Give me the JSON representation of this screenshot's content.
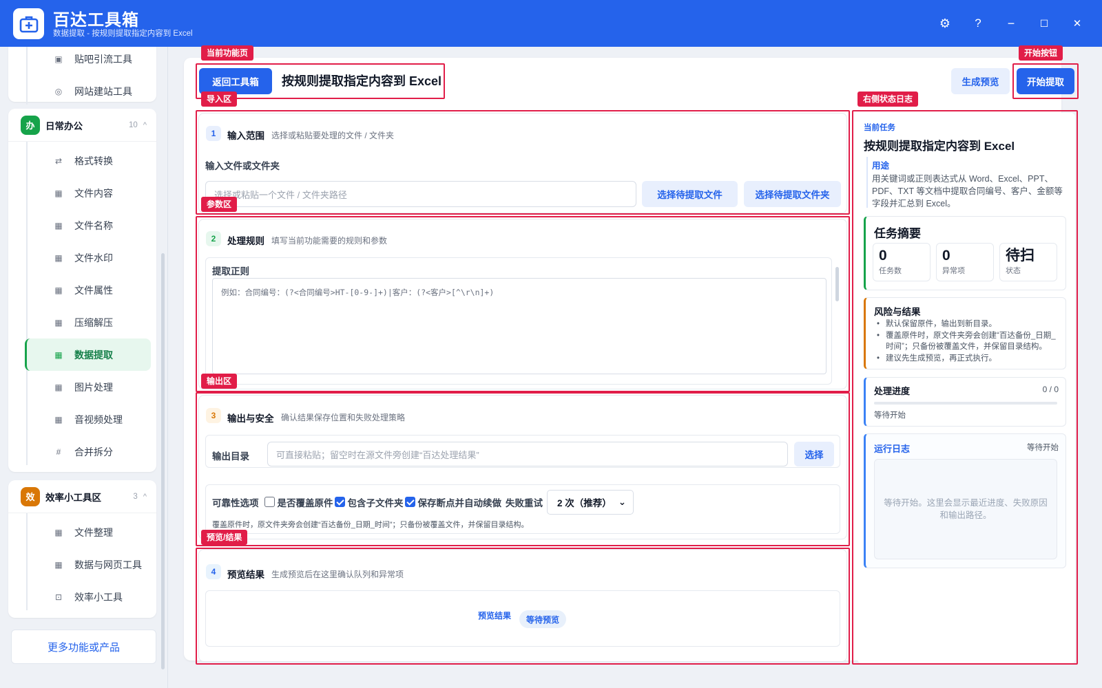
{
  "app": {
    "title": "百达工具箱",
    "subtitle": "数据提取 - 按规则提取指定内容到 Excel"
  },
  "window": {
    "settings_glyph": "⚙",
    "help_glyph": "?",
    "minimize_glyph": "−",
    "maximize_glyph": "☐",
    "close_glyph": "✕"
  },
  "sidebar": {
    "top_items": [
      {
        "label": "贴吧引流工具",
        "icon": "grid-icon"
      },
      {
        "label": "网站建站工具",
        "icon": "globe-icon"
      }
    ],
    "groups": [
      {
        "badge": "办",
        "color": "#16a34a",
        "name": "日常办公",
        "count": "10",
        "caret": "^",
        "items": [
          {
            "label": "格式转换",
            "icon": "swap-icon"
          },
          {
            "label": "文件内容",
            "icon": "grid-icon"
          },
          {
            "label": "文件名称",
            "icon": "grid-icon"
          },
          {
            "label": "文件水印",
            "icon": "grid-icon"
          },
          {
            "label": "文件属性",
            "icon": "grid-icon"
          },
          {
            "label": "压缩解压",
            "icon": "grid-icon"
          },
          {
            "label": "数据提取",
            "icon": "grid-icon",
            "active": true
          },
          {
            "label": "图片处理",
            "icon": "grid-icon"
          },
          {
            "label": "音视频处理",
            "icon": "grid-icon"
          },
          {
            "label": "合并拆分",
            "icon": "hash-icon"
          }
        ]
      },
      {
        "badge": "效",
        "color": "#d97706",
        "name": "效率小工具区",
        "count": "3",
        "caret": "^",
        "items": [
          {
            "label": "文件整理",
            "icon": "grid-icon"
          },
          {
            "label": "数据与网页工具",
            "icon": "grid-icon"
          },
          {
            "label": "效率小工具",
            "icon": "toolbox-icon"
          }
        ]
      }
    ],
    "more_label": "更多功能或产品"
  },
  "header": {
    "back_label": "返回工具箱",
    "title": "按规则提取指定内容到 Excel",
    "preview_label": "生成预览",
    "start_label": "开始提取"
  },
  "section1": {
    "num": "1",
    "title": "输入范围",
    "desc": "选择或粘贴要处理的文件 / 文件夹",
    "field_label": "输入文件或文件夹",
    "placeholder": "选择或粘贴一个文件 / 文件夹路径",
    "pick_file": "选择待提取文件",
    "pick_folder": "选择待提取文件夹"
  },
  "section2": {
    "num": "2",
    "title": "处理规则",
    "desc": "填写当前功能需要的规则和参数",
    "field_label": "提取正则",
    "placeholder": "例如：合同编号：(?<合同编号>HT-[0-9-]+)|客户：(?<客户>[^\\r\\n]+)"
  },
  "section3": {
    "num": "3",
    "title": "输出与安全",
    "desc": "确认结果保存位置和失败处理策略",
    "out_label": "输出目录",
    "out_placeholder": "可直接粘贴；留空时在源文件旁创建“百达处理结果”",
    "choose": "选择",
    "options_label": "可靠性选项",
    "overwrite": "是否覆盖原件",
    "include_sub": "包含子文件夹",
    "resume": "保存断点并自动续做",
    "retry_label": "失败重试",
    "retry_value": "2 次（推荐）",
    "note": "覆盖原件时，原文件夹旁会创建“百达备份_日期_时间”；只备份被覆盖文件，并保留目录结构。"
  },
  "section4": {
    "num": "4",
    "title": "预览结果",
    "desc": "生成预览后在这里确认队列和异常项",
    "result_label": "预览结果",
    "pill": "等待预览"
  },
  "right": {
    "current_label": "当前任务",
    "task_title": "按规则提取指定内容到 Excel",
    "purpose_label": "用途",
    "purpose_text": "用关键词或正则表达式从 Word、Excel、PPT、PDF、TXT 等文档中提取合同编号、客户、金额等字段并汇总到 Excel。",
    "summary_title": "任务摘要",
    "stats": [
      {
        "value": "0",
        "label": "任务数"
      },
      {
        "value": "0",
        "label": "异常项"
      },
      {
        "value": "待扫",
        "label": "状态"
      }
    ],
    "risk_title": "风险与结果",
    "risks": [
      "默认保留原件，输出到新目录。",
      "覆盖原件时，原文件夹旁会创建“百达备份_日期_时间”；只备份被覆盖文件，并保留目录结构。",
      "建议先生成预览，再正式执行。"
    ],
    "progress_title": "处理进度",
    "progress_count": "0 / 0",
    "progress_value": 0,
    "progress_status": "等待开始",
    "log_title": "运行日志",
    "log_status": "等待开始",
    "log_text": "等待开始。这里会显示最近进度、失败原因和输出路径。"
  },
  "annotations": {
    "current_page": "当前功能页",
    "start_btn": "开始按钮",
    "import": "导入区",
    "right_log": "右侧状态日志",
    "params": "参数区",
    "output": "输出区",
    "preview": "预览/结果"
  },
  "colors": {
    "brand": "#2563eb",
    "active_green": "#16a34a",
    "annotation_red": "#e11d48",
    "accent_orange": "#d97706"
  }
}
